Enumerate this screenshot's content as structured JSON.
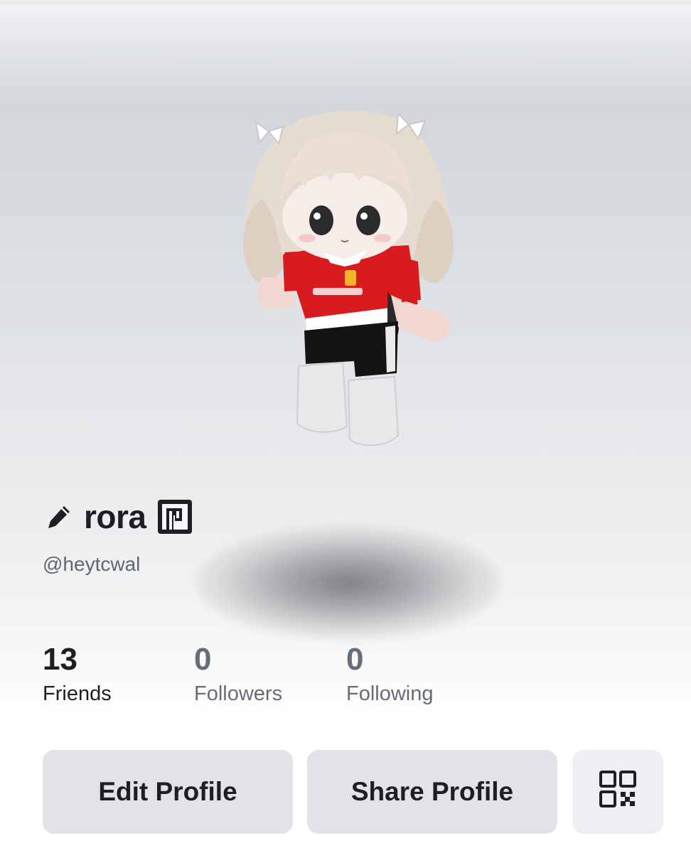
{
  "profile": {
    "display_name": "rora",
    "username": "@heytcwal"
  },
  "stats": [
    {
      "value": "13",
      "label": "Friends"
    },
    {
      "value": "0",
      "label": "Followers"
    },
    {
      "value": "0",
      "label": "Following"
    }
  ],
  "actions": {
    "edit_label": "Edit Profile",
    "share_label": "Share Profile",
    "qr_icon": "qr-code-icon"
  },
  "icons": {
    "edit_name": "pencil-icon",
    "premium": "premium-badge-icon"
  },
  "colors": {
    "text_primary": "#1e1f23",
    "text_muted": "#666d78",
    "button_bg": "#e2e3e7",
    "shirt_red": "#d81b1f"
  }
}
